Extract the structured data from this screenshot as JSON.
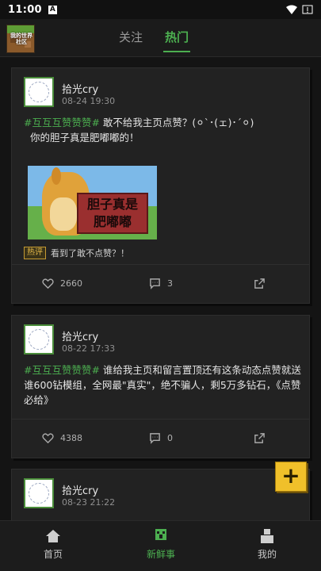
{
  "status_bar": {
    "time": "11:00",
    "badge": "A"
  },
  "header": {
    "logo_text": "我的世界社区",
    "tabs": [
      {
        "label": "关注",
        "active": false
      },
      {
        "label": "热门",
        "active": true
      }
    ]
  },
  "posts": [
    {
      "author": "拾光cry",
      "timestamp": "08-24 19:30",
      "hashtag": "#互互互赞赞赞#",
      "text": " 敢不给我主页点赞？(⚪︎`･(ェ)･´⚪︎)",
      "text_line2": "你的胆子真是肥嘟嘟的！",
      "image_text_line1": "胆子真是",
      "image_text_line2": "肥嘟嘟",
      "hot_label": "热评",
      "hot_comment": "看到了敢不点赞？！",
      "likes": "2660",
      "comments": "3"
    },
    {
      "author": "拾光cry",
      "timestamp": "08-22 17:33",
      "hashtag": "#互互互赞赞赞#",
      "text": " 谁给我主页和留言置顶还有这条动态点赞就送谁600钻模组，全网最\"真实\"，绝不骗人，剩5万多钻石，《点赞必给》",
      "likes": "4388",
      "comments": "0"
    },
    {
      "author": "拾光cry",
      "timestamp": "08-23 21:22"
    }
  ],
  "fab": {
    "label": "+"
  },
  "bottom_nav": [
    {
      "label": "首页",
      "icon": "home-icon",
      "active": false
    },
    {
      "label": "新鲜事",
      "icon": "creeper-icon",
      "active": true
    },
    {
      "label": "我的",
      "icon": "profile-icon",
      "active": false
    }
  ],
  "colors": {
    "accent": "#4caf50",
    "fab": "#f0c02a",
    "background": "#141414",
    "card": "#222222"
  }
}
